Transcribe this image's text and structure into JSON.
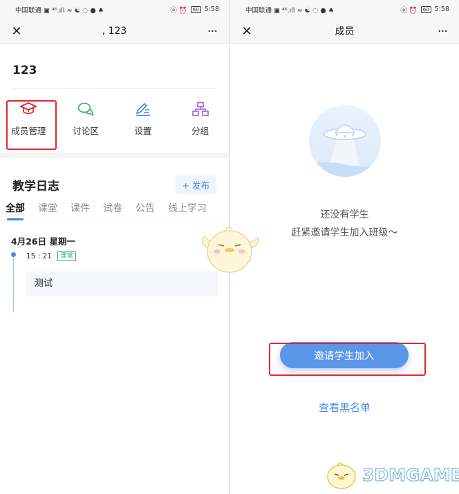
{
  "left": {
    "status_bar": {
      "carrier": "中国联通 ▣ ⁴⁶.ıll ≈ ☯ ◌ ● ♠",
      "right_icons": "ⓞ ⏰",
      "battery": "60",
      "time": "5:58"
    },
    "nav": {
      "close_icon": "close-icon",
      "title": ", 123",
      "more": "···"
    },
    "class_name": "123",
    "menu": [
      {
        "label": "成员管理",
        "icon": "graduation-cap-icon",
        "color": "#e5262b"
      },
      {
        "label": "讨论区",
        "icon": "chat-bubbles-icon",
        "color": "#3bb273"
      },
      {
        "label": "设置",
        "icon": "pen-settings-icon",
        "color": "#4a8ae0"
      },
      {
        "label": "分组",
        "icon": "group-tree-icon",
        "color": "#9b5de5"
      }
    ],
    "log": {
      "title": "教学日志",
      "publish": "+ 发布",
      "tabs": [
        "全部",
        "课堂",
        "课件",
        "试卷",
        "公告",
        "线上学习"
      ],
      "active_tab": "全部",
      "date": "4月26日  星期一",
      "entry": {
        "time": "15 : 21",
        "badge": "课堂",
        "content": "测试"
      }
    }
  },
  "right": {
    "status_bar": {
      "carrier": "中国联通 ▣ ⁴⁶.ıll ≈ ☯ ◌ ● ♠",
      "right_icons": "ⓞ ⏰",
      "battery": "60",
      "time": "5:58"
    },
    "nav": {
      "close_icon": "close-icon",
      "title": "成员",
      "more": "···"
    },
    "empty": {
      "line1": "还没有学生",
      "line2": "赶紧邀请学生加入班级～",
      "illustration": "ufo-illustration"
    },
    "invite_button": "邀请学生加入",
    "blacklist_link": "查看黑名单"
  },
  "watermark": "3DMGAME",
  "colors": {
    "accent": "#4a8ae0",
    "highlight": "#e5262b",
    "badge": "#3bb273",
    "invite": "#5b97e8"
  }
}
